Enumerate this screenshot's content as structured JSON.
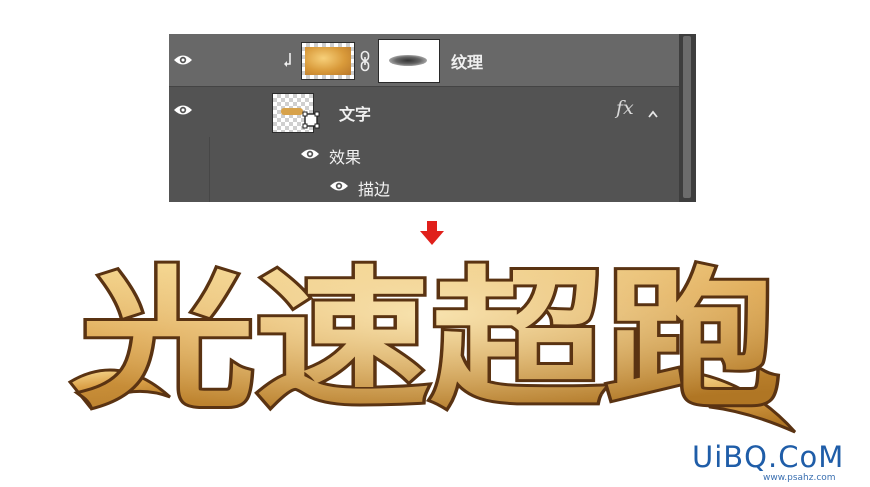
{
  "layers_panel": {
    "layers": [
      {
        "name": "纹理",
        "visible": true,
        "clipped": true,
        "has_mask": true
      },
      {
        "name": "文字",
        "visible": true,
        "fx_label": "fx",
        "expanded": true
      }
    ],
    "effects_label": "效果",
    "effect_items": [
      {
        "name": "描边"
      }
    ]
  },
  "artwork": {
    "title_text": "光速超跑",
    "colors": {
      "gold_light": "#f6d58a",
      "gold_mid": "#d9a046",
      "gold_dark": "#a9711f",
      "outline": "#5a3312"
    }
  },
  "indicator": {
    "arrow_color": "#e0201b",
    "icon": "arrow-down-icon"
  },
  "watermark": {
    "main": "UiBQ.CoM",
    "sub": "www.psahz.com"
  },
  "panel_colors": {
    "panel_bg": "#535353",
    "selected_row_bg": "#686868",
    "text": "#f0f0f0"
  }
}
